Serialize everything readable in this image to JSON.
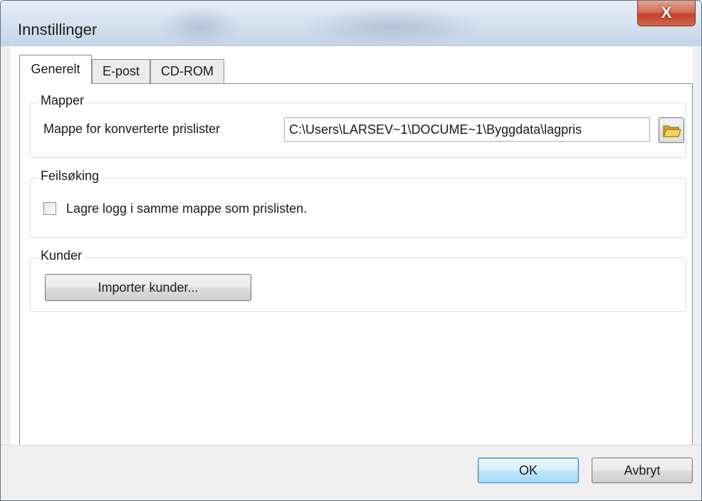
{
  "window": {
    "title": "Innstillinger",
    "close_label": "X"
  },
  "tabs": [
    {
      "label": "Generelt",
      "active": true
    },
    {
      "label": "E-post",
      "active": false
    },
    {
      "label": "CD-ROM",
      "active": false
    }
  ],
  "folders": {
    "group_title": "Mapper",
    "label": "Mappe for konverterte prislister",
    "path_value": "C:\\Users\\LARSEV~1\\DOCUME~1\\Byggdata\\lagpris",
    "browse_icon": "folder-open-icon"
  },
  "debug": {
    "group_title": "Feilsøking",
    "log_checkbox_label": "Lagre logg i samme mappe som prislisten.",
    "log_checked": false
  },
  "customers": {
    "group_title": "Kunder",
    "import_button": "Importer kunder..."
  },
  "footer": {
    "ok_label": "OK",
    "cancel_label": "Avbryt"
  },
  "colors": {
    "close_button": "#c4422a",
    "default_button_border": "#3c7fb1",
    "group_border": "#d5dfe5"
  }
}
